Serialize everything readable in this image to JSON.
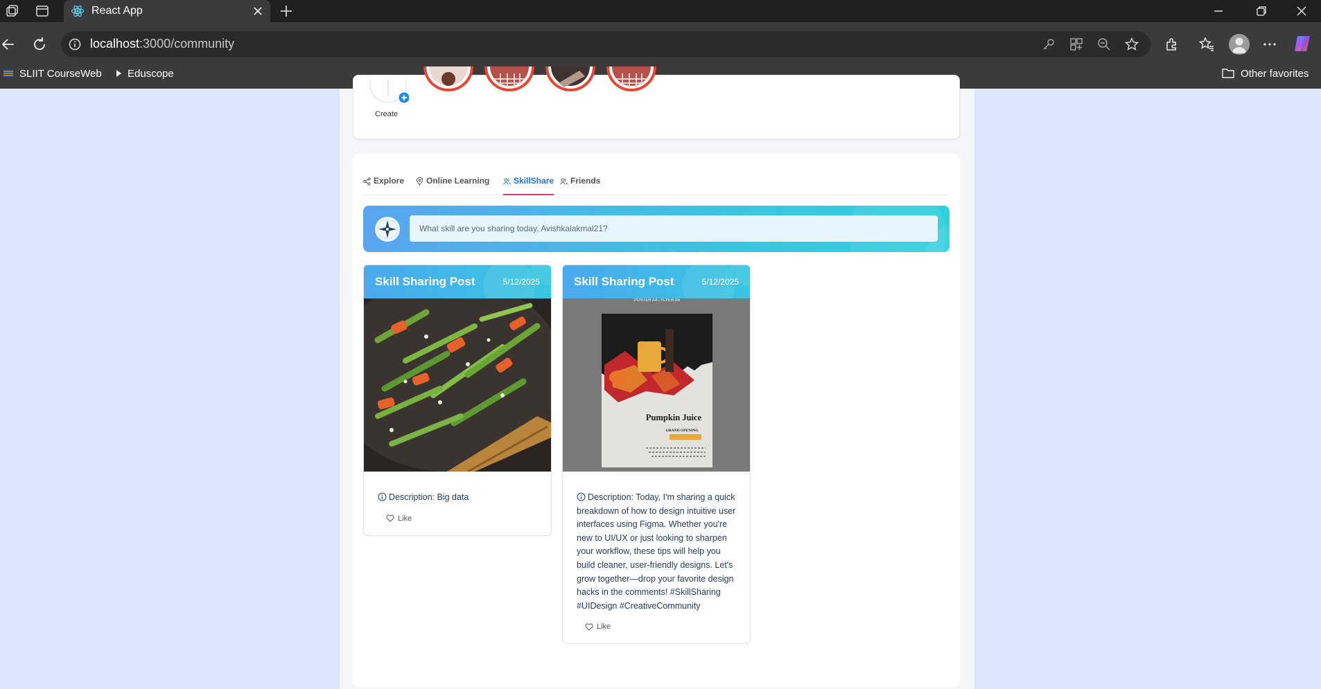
{
  "browser": {
    "tab_title": "React App",
    "url_host": "localhost",
    "url_rest": ":3000/community",
    "bookmarks": [
      {
        "label": "SLIIT CourseWeb"
      },
      {
        "label": "Eduscope"
      }
    ],
    "other_favorites": "Other favorites"
  },
  "stories": {
    "create_label": "Create"
  },
  "tabs": [
    {
      "label": "Explore",
      "icon": "share-icon",
      "active": false
    },
    {
      "label": "Online Learning",
      "icon": "location-pin-icon",
      "active": false
    },
    {
      "label": "SkillShare",
      "icon": "people-icon",
      "active": true
    },
    {
      "label": "Friends",
      "icon": "people-icon",
      "active": false
    }
  ],
  "composer": {
    "placeholder": "What skill are you sharing today, Avishkalakmal21?"
  },
  "posts": [
    {
      "title": "Skill Sharing Post",
      "date": "5/12/2025",
      "image": "stir-fry-green-beans-carrots-photo",
      "description": "Description: Big data",
      "like_label": "Like"
    },
    {
      "title": "Skill Sharing Post",
      "date": "5/12/2025",
      "image": "pumpkin-juice-poster",
      "poster_header": "POSTER A4 / FLYER A5",
      "poster_title": "Pumpkin Juice",
      "poster_sub": "GRAND OPENING",
      "description": "Description: Today, I'm sharing a quick breakdown of how to design intuitive user interfaces using Figma. Whether you're new to UI/UX or just looking to sharpen your workflow, these tips will help you build cleaner, user-friendly designs. Let's grow together—drop your favorite design hacks in the comments! #SkillSharing #UIDesign #CreativeCommunity",
      "like_label": "Like"
    }
  ],
  "colors": {
    "accent": "#1a73e8",
    "tab_underline": "#e8336d",
    "header_gradient_start": "#4aa9ee",
    "header_gradient_end": "#38c7e0",
    "page_bg": "#dde6fb"
  }
}
